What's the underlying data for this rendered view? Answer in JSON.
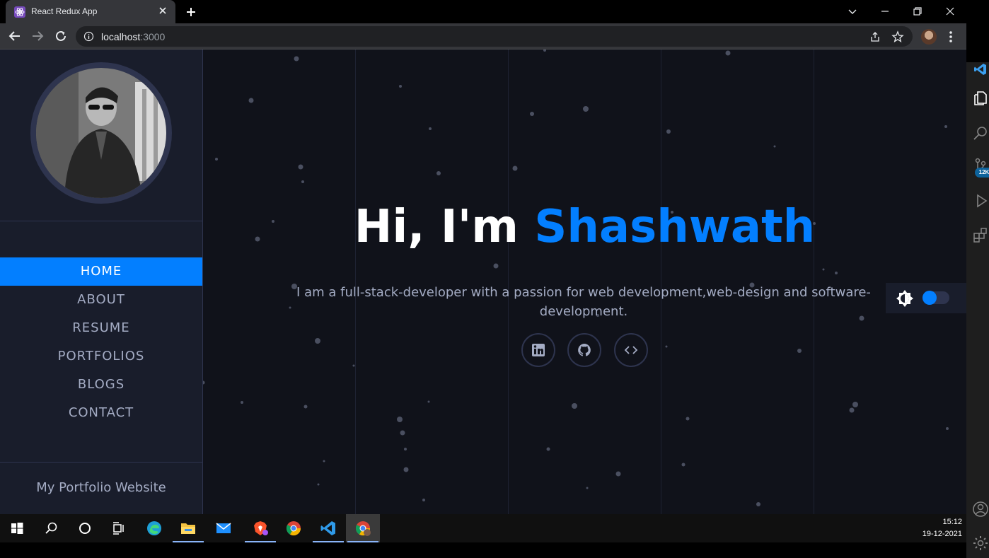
{
  "browser": {
    "tab_title": "React Redux App",
    "url_host": "localhost",
    "url_port": ":3000"
  },
  "sidebar": {
    "nav": [
      {
        "label": "HOME",
        "active": true
      },
      {
        "label": "ABOUT"
      },
      {
        "label": "RESUME"
      },
      {
        "label": "PORTFOLIOS"
      },
      {
        "label": "BLOGS"
      },
      {
        "label": "CONTACT"
      }
    ],
    "footer": "My Portfolio Website"
  },
  "hero": {
    "greeting": "Hi, I'm ",
    "name": "Shashwath",
    "subtitle": "I am a full-stack-developer with a passion for web development,web-design and software-development.",
    "socials": [
      "linkedin-icon",
      "github-icon",
      "code-icon"
    ]
  },
  "theme_toggle": {
    "icon": "brightness-icon",
    "dark_mode": false
  },
  "taskbar": {
    "apps": [
      "windows-start",
      "search",
      "cortana",
      "task-view",
      "edge",
      "file-explorer",
      "mail",
      "brave",
      "chrome",
      "vscode",
      "chrome-profile"
    ],
    "time": "15:12",
    "date": "19-12-2021"
  },
  "vscode": {
    "badge": "12K"
  },
  "colors": {
    "accent": "#037fff",
    "page_bg": "#10121a",
    "sidebar_bg": "#191d2b",
    "border": "#2e344e",
    "text_muted": "#a4acc4"
  }
}
